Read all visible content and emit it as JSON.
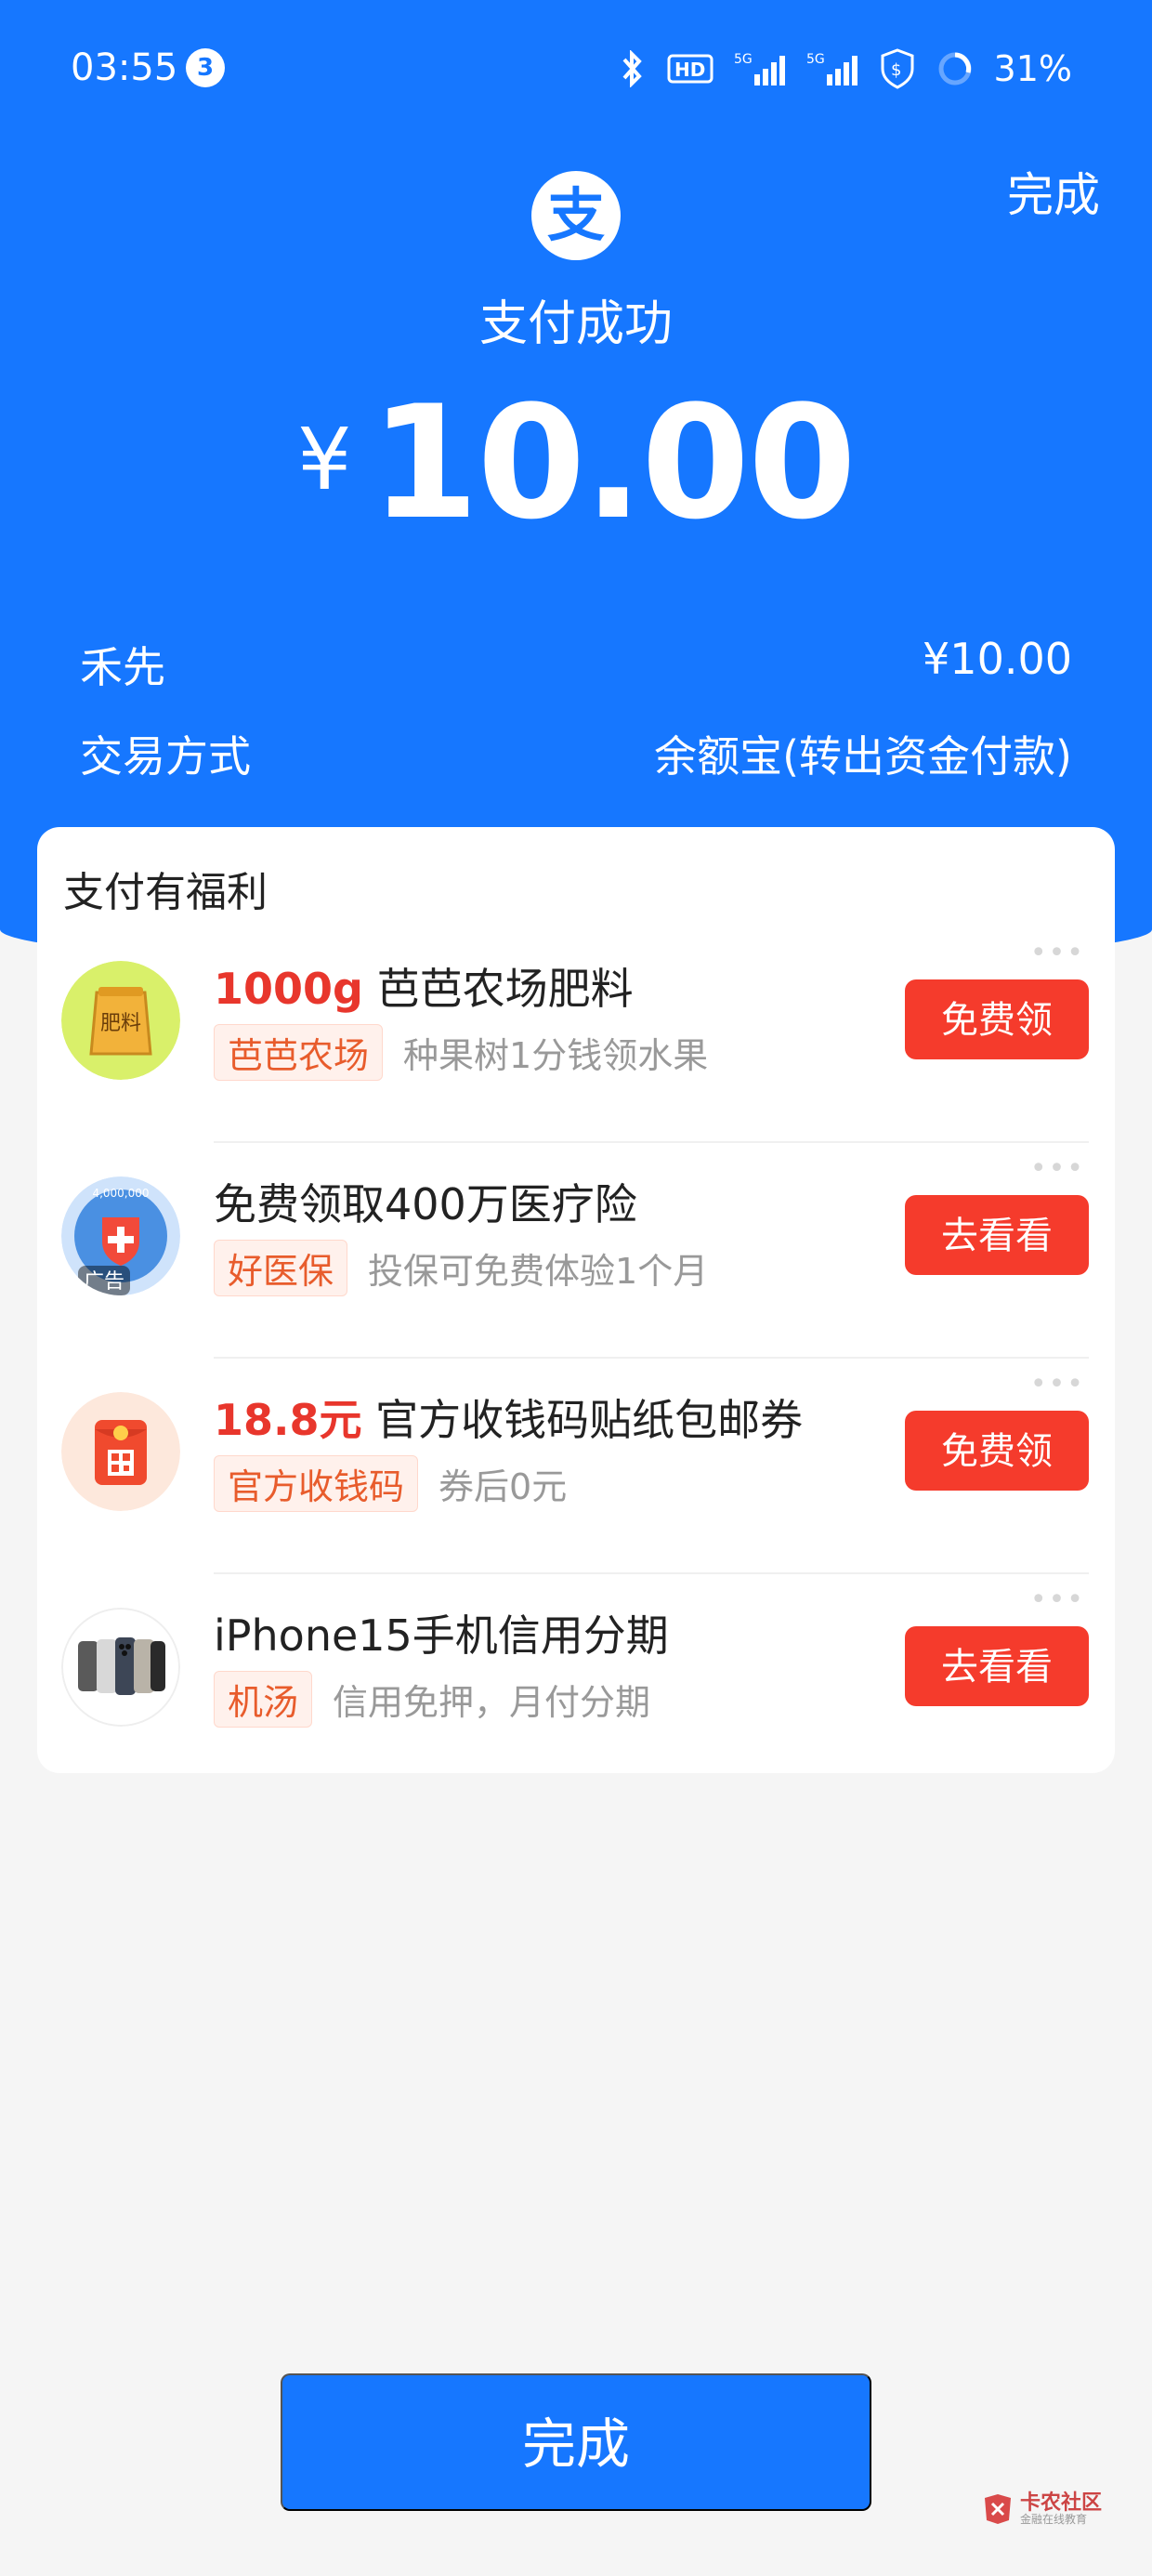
{
  "status_bar": {
    "time": "03:55",
    "notification_count": "3",
    "battery": "31%"
  },
  "header": {
    "done_label": "完成",
    "logo_char": "支",
    "pay_status": "支付成功",
    "currency_symbol": "¥",
    "amount": "10.00",
    "payee": "禾先",
    "payee_amount": "¥10.00",
    "method_label": "交易方式",
    "method_value": "余额宝(转出资金付款)"
  },
  "benefits": {
    "title": "支付有福利",
    "items": [
      {
        "highlight": "1000g",
        "title": " 芭芭农场肥料",
        "tag": "芭芭农场",
        "desc": "种果树1分钱领水果",
        "button": "免费领",
        "thumb_text": "肥料"
      },
      {
        "highlight": "",
        "title": "免费领取400万医疗险",
        "tag": "好医保",
        "desc": "投保可免费体验1个月",
        "button": "去看看",
        "thumb_text": "广告",
        "thumb_sub": "4,000,000"
      },
      {
        "highlight": "18.8元",
        "title": " 官方收钱码贴纸包邮券",
        "tag": "官方收钱码",
        "desc": "券后0元",
        "button": "免费领"
      },
      {
        "highlight": "",
        "title": "iPhone15手机信用分期",
        "tag": "机汤",
        "desc": "信用免押，月付分期",
        "button": "去看看"
      }
    ]
  },
  "footer": {
    "done_label": "完成"
  },
  "watermark": {
    "main": "卡农社区",
    "sub": "金融在线教育"
  },
  "colors": {
    "brand_blue": "#1677ff",
    "action_red": "#f53b2c",
    "highlight_red": "#e8362c"
  }
}
